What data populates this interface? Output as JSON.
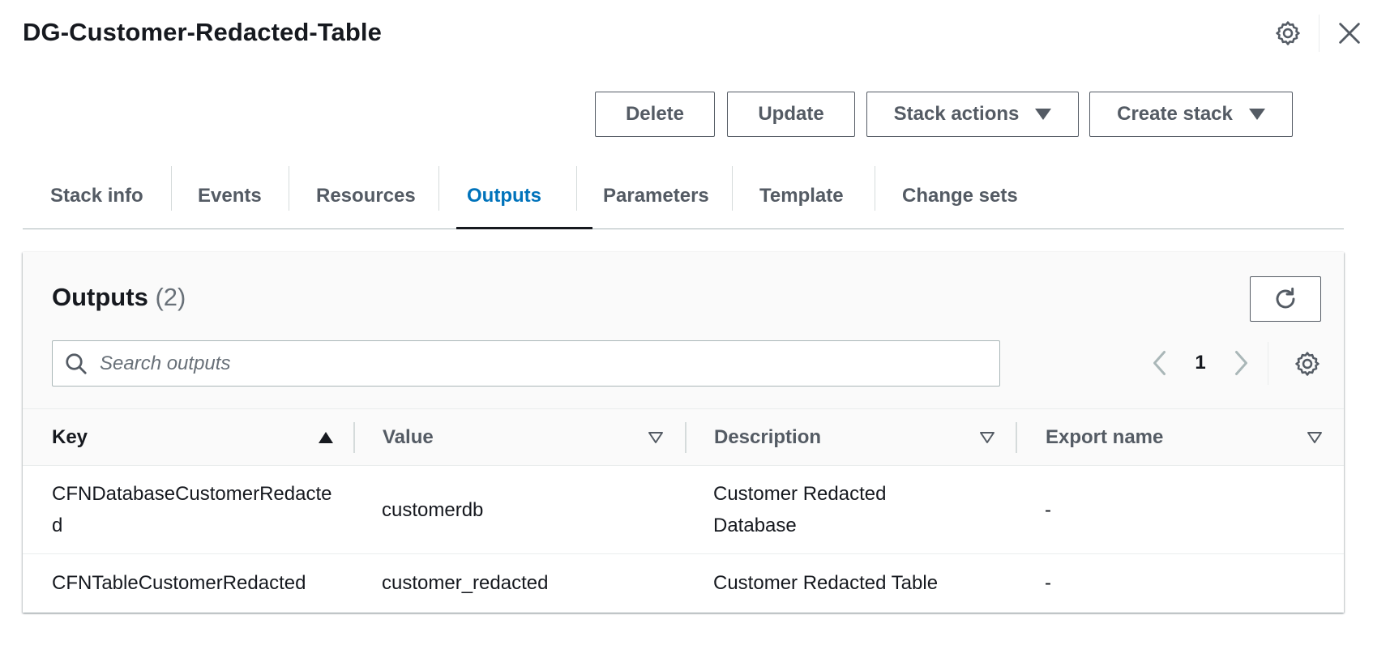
{
  "header": {
    "title": "DG-Customer-Redacted-Table",
    "settings_icon": "gear-icon",
    "close_icon": "close-icon"
  },
  "actions": {
    "delete_label": "Delete",
    "update_label": "Update",
    "stack_actions_label": "Stack actions",
    "create_stack_label": "Create stack"
  },
  "tabs": [
    {
      "label": "Stack info",
      "active": false
    },
    {
      "label": "Events",
      "active": false
    },
    {
      "label": "Resources",
      "active": false
    },
    {
      "label": "Outputs",
      "active": true
    },
    {
      "label": "Parameters",
      "active": false
    },
    {
      "label": "Template",
      "active": false
    },
    {
      "label": "Change sets",
      "active": false
    }
  ],
  "outputs": {
    "title": "Outputs",
    "count": "(2)",
    "search": {
      "placeholder": "Search outputs",
      "value": ""
    },
    "pagination": {
      "current_page": "1"
    },
    "columns": [
      {
        "label": "Key",
        "sort": "ascending"
      },
      {
        "label": "Value",
        "sort": "none"
      },
      {
        "label": "Description",
        "sort": "none"
      },
      {
        "label": "Export name",
        "sort": "none"
      }
    ],
    "rows": [
      {
        "key": "CFNDatabaseCustomerRedacted",
        "value": "customerdb",
        "description": "Customer Redacted Database",
        "export_name": "-"
      },
      {
        "key": "CFNTableCustomerRedacted",
        "value": "customer_redacted",
        "description": "Customer Redacted Table",
        "export_name": "-"
      }
    ]
  },
  "colors": {
    "accent": "#0073bb",
    "text": "#16191f",
    "muted": "#545b64",
    "border": "#aab7b8"
  }
}
